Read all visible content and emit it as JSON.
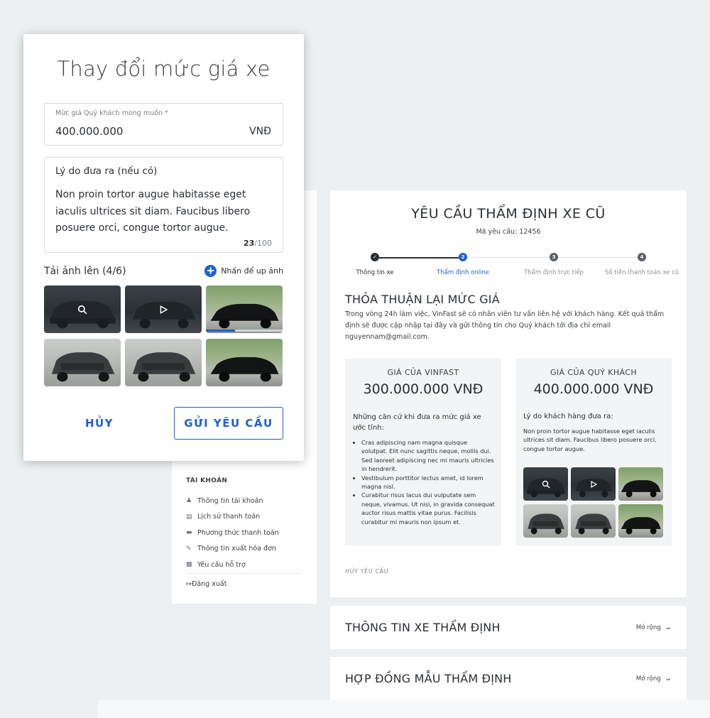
{
  "modal": {
    "title": "Thay đổi mức giá xe",
    "price_label": "Mức giá Quý khách mong muốn *",
    "price_value": "400.000.000",
    "price_unit": "VNĐ",
    "reason_label": "Lý do đưa ra (nếu có)",
    "reason_text": "Non proin tortor augue habitasse eget iaculis ultrices sit diam. Faucibus libero posuere orci, congue tortor augue.",
    "char_count": "23",
    "char_max": "/100",
    "upload_label": "Tải ảnh lên (4/6)",
    "upload_button": "Nhấn để up ảnh",
    "upload_progress": 0.38,
    "cancel_label": "HỦY",
    "submit_label": "GỬI YÊU CẦU"
  },
  "sidebar": {
    "heading": "TÀI KHOẢN",
    "items": [
      {
        "label": "Thông tin tài khoản",
        "icon": "user-icon"
      },
      {
        "label": "Lịch sử thanh toán",
        "icon": "history-icon"
      },
      {
        "label": "Phương thức thanh toán",
        "icon": "card-icon"
      },
      {
        "label": "Thông tin xuất hóa đơn",
        "icon": "invoice-icon"
      },
      {
        "label": "Yêu cầu hỗ trợ",
        "icon": "support-icon"
      }
    ],
    "logout": "Đăng xuất"
  },
  "main": {
    "title": "YÊU CẦU THẨM ĐỊNH XE CŨ",
    "request_code": "Mã yêu cầu: 12456",
    "steps": [
      {
        "label": "Thông tin xe",
        "num": "✓",
        "state": "done"
      },
      {
        "label": "Thẩm định online",
        "num": "2",
        "state": "active"
      },
      {
        "label": "Thẩm định trực tiếp",
        "num": "3",
        "state": "pending"
      },
      {
        "label": "Số tiền thanh toán xe cũ",
        "num": "4",
        "state": "pending"
      }
    ],
    "section_title": "THỎA THUẬN LẠI MỨC GIÁ",
    "section_desc": "Trong vòng 24h làm việc, VinFast sẽ có nhân viên tư vấn liên hệ với khách hàng. Kết quả thẩm định sẽ được cập nhập tại đây và gửi thông tin cho Quý khách tới địa chỉ email nguyennam@gmail.com.",
    "vinfast_price": {
      "label": "GIÁ CỦA VINFAST",
      "value": "300.000.000 VNĐ",
      "basis_label": "Những căn cứ khi đưa ra mức giá xe ước tính:",
      "bullets": [
        "Cras adipiscing nam magna quisque volutpat. Elit nunc sagittis neque, mollis dui. Sed laoreet adipiscing nec mi mauris ultricies in hendrerit.",
        "Vestibulum porttitor lectus amet, id lorem magna nisl.",
        "Curabitur risus lacus dui vulputate sem neque, vivamus. Ut nisi, in gravida consequat auctor risus mattis vitae purus. Facilisis curabitur mi mauris non ipsum et."
      ]
    },
    "customer_price": {
      "label": "GIÁ CỦA QUÝ KHÁCH",
      "value": "400.000.000 VNĐ",
      "reason_label": "Lý do khách hàng đưa ra:",
      "reason_text": "Non proin tortor augue habitasse eget iaculis ultrices sit diam. Faucibus libero posuere orci, congue tortor augue."
    },
    "cancel_request": "HỦY YÊU CẦU"
  },
  "sections": [
    {
      "title": "THÔNG TIN XE THẨM ĐỊNH",
      "toggle": "Mở rộng"
    },
    {
      "title": "HỢP ĐỒNG MẪU THẨM ĐỊNH",
      "toggle": "Mở rộng"
    }
  ],
  "colors": {
    "accent": "#1f5fd1",
    "background": "#edf0f2",
    "text": "#2b2f33"
  }
}
